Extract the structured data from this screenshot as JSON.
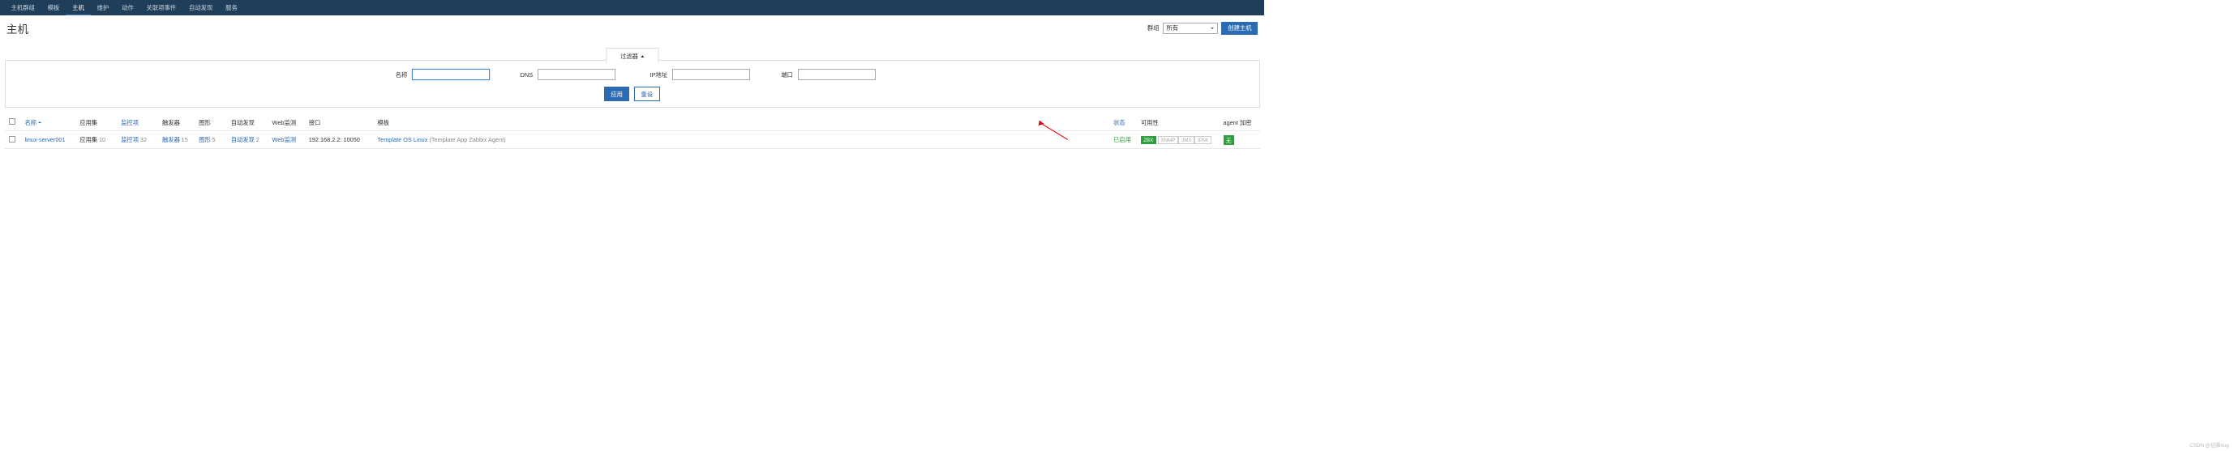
{
  "nav": {
    "items": [
      "主机群组",
      "模板",
      "主机",
      "维护",
      "动作",
      "关联项事件",
      "自动发现",
      "服务"
    ],
    "active_index": 2
  },
  "page": {
    "title": "主机"
  },
  "header_controls": {
    "group_label": "群组",
    "group_value": "所有",
    "create_button": "创建主机"
  },
  "filter": {
    "tab_label": "过滤器",
    "fields": {
      "name_label": "名称",
      "dns_label": "DNS",
      "ip_label": "IP地址",
      "port_label": "端口"
    },
    "apply_button": "应用",
    "reset_button": "重设"
  },
  "table": {
    "headers": {
      "name": "名称",
      "apps": "应用集",
      "items": "监控项",
      "triggers": "触发器",
      "graphs": "图形",
      "discovery": "自动发现",
      "web": "Web监测",
      "interface": "接口",
      "templates": "模板",
      "status": "状态",
      "availability": "可用性",
      "agent_enc": "agent 加密"
    },
    "rows": [
      {
        "name": "linux-server001",
        "apps": {
          "label": "应用集",
          "count": "10"
        },
        "items": {
          "label": "监控项",
          "count": "32"
        },
        "triggers": {
          "label": "触发器",
          "count": "15"
        },
        "graphs": {
          "label": "图形",
          "count": "5"
        },
        "discovery": {
          "label": "自动发现",
          "count": "2"
        },
        "web": "Web监测",
        "interface": "192.168.2.2: 10050",
        "template_main": "Template OS Linux",
        "template_sub": "Template App Zabbix Agent",
        "status": "已启用",
        "avail": {
          "zbx": "ZBX",
          "snmp": "SNMP",
          "jmx": "JMX",
          "ipmi": "IPMI"
        },
        "enc": "无"
      }
    ]
  },
  "watermark": "CSDN @征服bug"
}
